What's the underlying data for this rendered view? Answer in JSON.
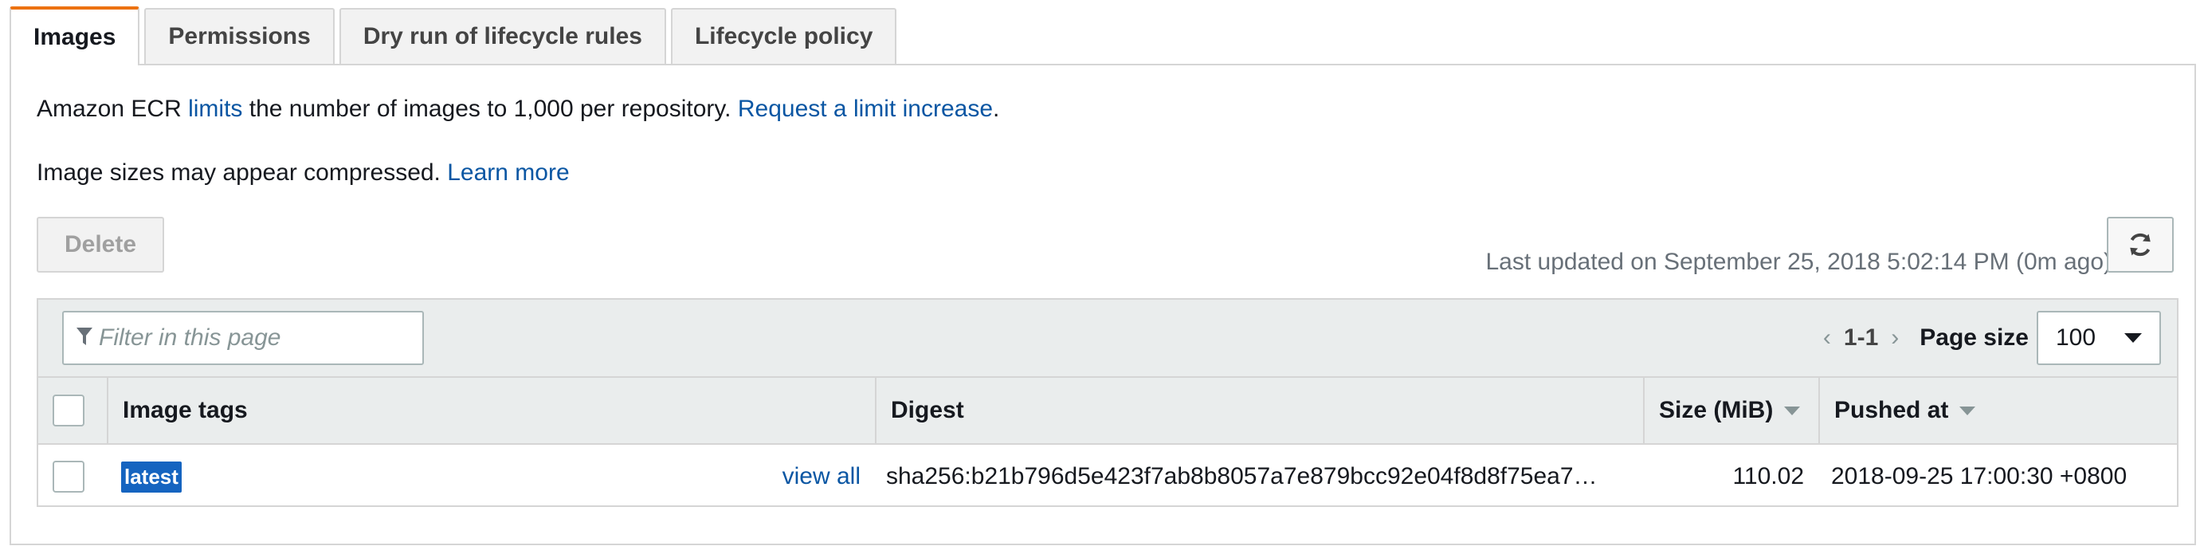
{
  "tabs": [
    {
      "label": "Images",
      "active": true
    },
    {
      "label": "Permissions",
      "active": false
    },
    {
      "label": "Dry run of lifecycle rules",
      "active": false
    },
    {
      "label": "Lifecycle policy",
      "active": false
    }
  ],
  "info": {
    "line1_prefix": "Amazon ECR ",
    "line1_link": "limits",
    "line1_middle": " the number of images to 1,000 per repository. ",
    "line1_link2": "Request a limit increase",
    "line1_suffix": ".",
    "line2_text": "Image sizes may appear compressed. ",
    "line2_link": "Learn more"
  },
  "actions": {
    "delete_label": "Delete",
    "last_updated": "Last updated on September 25, 2018 5:02:14 PM (0m ago)",
    "refresh_icon": "refresh-icon"
  },
  "table": {
    "filter_placeholder": "Filter in this page",
    "pagination": {
      "prev": "‹",
      "range": "1-1",
      "next": "›",
      "page_size_label": "Page size",
      "page_size_value": "100"
    },
    "columns": [
      "Image tags",
      "Digest",
      "Size (MiB)",
      "Pushed at"
    ],
    "rows": [
      {
        "tag": "latest",
        "view_all": "view all",
        "digest": "sha256:b21b796d5e423f7ab8b8057a7e879bcc92e04f8d8f75ea7…",
        "size": "110.02",
        "pushed_at": "2018-09-25 17:00:30 +0800"
      }
    ]
  },
  "colors": {
    "accent_tab": "#ec7211",
    "link": "#0a56a3",
    "tag_bg": "#1564c0"
  }
}
